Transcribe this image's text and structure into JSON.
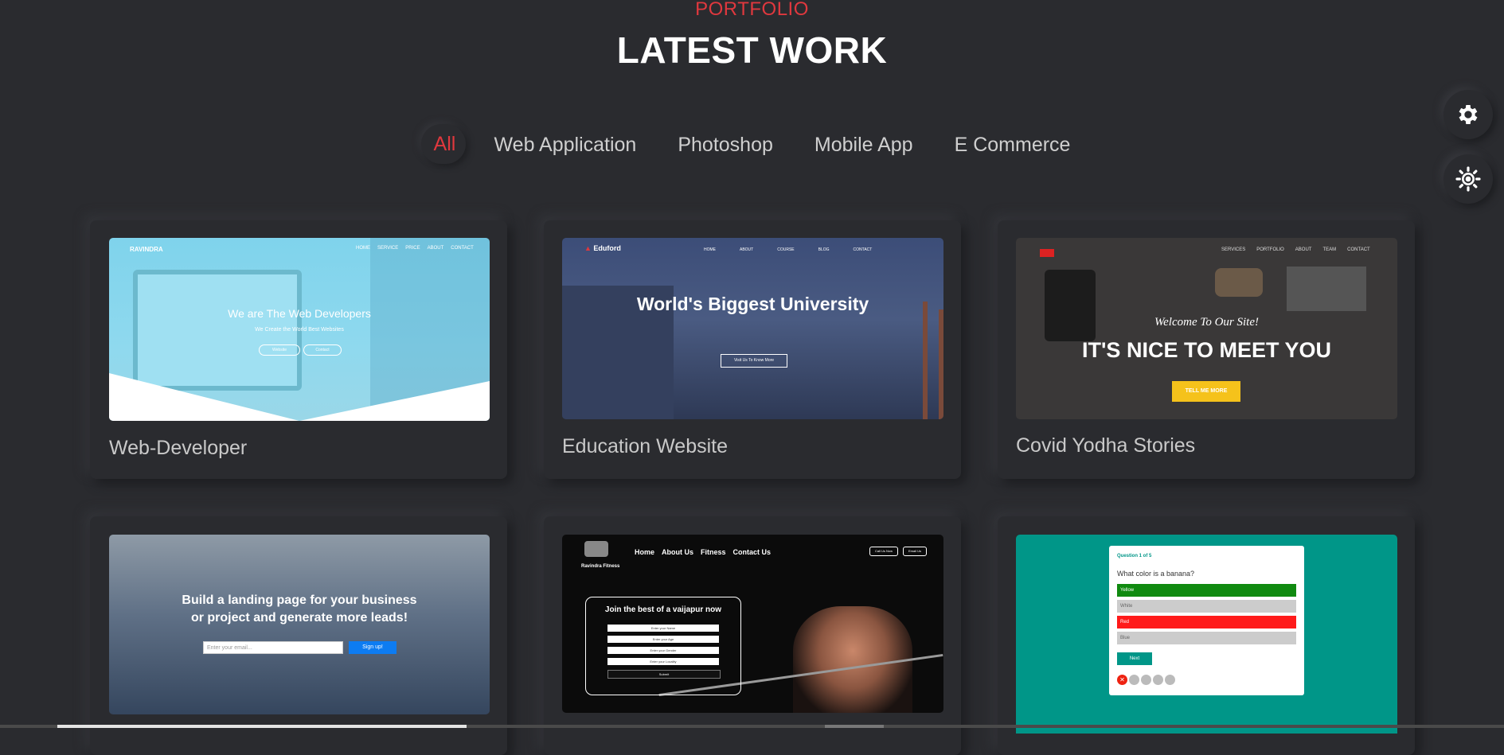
{
  "header": {
    "eyebrow": "PORTFOLIO",
    "title": "LATEST WORK"
  },
  "filters": [
    "All",
    "Web Application",
    "Photoshop",
    "Mobile App",
    "E Commerce"
  ],
  "side_buttons": {
    "settings_icon": "gear-icon",
    "theme_icon": "sun-icon"
  },
  "colors": {
    "accent": "#e0383e",
    "background": "#2a2b2f"
  },
  "projects": [
    {
      "title": "Web-Developer",
      "thumb": {
        "brand": "RAVINDRA",
        "nav": [
          "HOME",
          "SERVICE",
          "PRICE",
          "ABOUT",
          "CONTACT"
        ],
        "headline": "We are The Web Developers",
        "sub": "We Create the World Best Websites",
        "btn1": "Website",
        "btn2": "Contact"
      }
    },
    {
      "title": "Education Website",
      "thumb": {
        "brand": "Eduford",
        "nav": [
          "HOME",
          "ABOUT",
          "COURSE",
          "BLOG",
          "CONTACT"
        ],
        "headline": "World's Biggest University",
        "btn": "Visit Us To Know More"
      }
    },
    {
      "title": "Covid Yodha Stories",
      "thumb": {
        "nav": [
          "SERVICES",
          "PORTFOLIO",
          "ABOUT",
          "TEAM",
          "CONTACT"
        ],
        "welcome": "Welcome To Our Site!",
        "headline": "IT'S NICE TO MEET YOU",
        "btn": "TELL ME MORE"
      }
    },
    {
      "title": "",
      "thumb": {
        "headline1": "Build a landing page for your business",
        "headline2": "or project and generate more leads!",
        "placeholder": "Enter your email...",
        "btn": "Sign up!"
      }
    },
    {
      "title": "",
      "thumb": {
        "brand": "Ravindra Fitness",
        "nav": [
          "Home",
          "About Us",
          "Fitness",
          "Contact Us"
        ],
        "btn1": "Call Us Now",
        "btn2": "Email Us",
        "form_title": "Join the best of a vaijapur now",
        "fields": [
          "Enter your Name",
          "Enter your Age",
          "Enter your Gender",
          "Enter your Locality"
        ],
        "submit": "Submit"
      }
    },
    {
      "title": "",
      "thumb": {
        "question": "Question 1 of 5",
        "prompt": "What color is a banana?",
        "options": [
          "Yellow",
          "White",
          "Red",
          "Blue"
        ],
        "btn": "Next"
      }
    }
  ]
}
